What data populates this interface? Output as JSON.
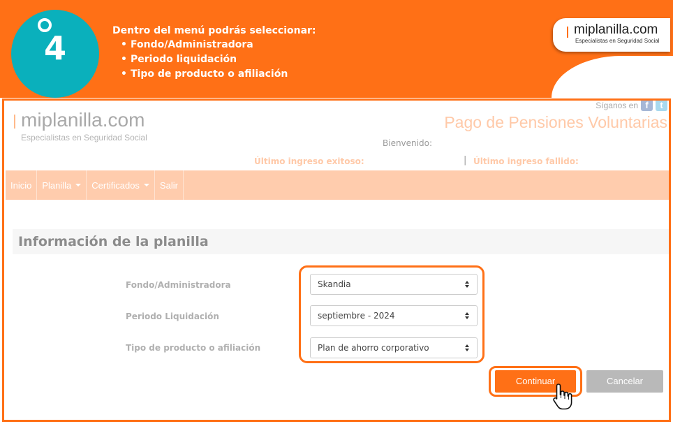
{
  "banner": {
    "step_number": "4",
    "intro": "Dentro del menú podrás seleccionar:",
    "items": [
      "Fondo/Administradora",
      "Periodo liquidación",
      "Tipo de producto o afiliación"
    ],
    "logo_name": "miplanilla.com",
    "logo_tagline": "Especialistas en Seguridad Social"
  },
  "site": {
    "logo_name": "miplanilla.com",
    "logo_tagline": "Especialistas en Seguridad Social",
    "follow_label": "Síganos en",
    "social_icons": [
      "facebook-icon",
      "twitter-icon"
    ],
    "page_heading": "Pago de Pensiones Voluntarias",
    "welcome": "Bienvenido:",
    "last_success_label": "Último ingreso exitoso:",
    "last_fail_label": "Último ingreso fallido:",
    "separator": "|"
  },
  "nav": {
    "items": [
      {
        "label": "Inicio",
        "dropdown": false
      },
      {
        "label": "Planilla",
        "dropdown": true
      },
      {
        "label": "Certificados",
        "dropdown": true
      },
      {
        "label": "Salir",
        "dropdown": false
      }
    ]
  },
  "form": {
    "section_title": "Información de la planilla",
    "fields": [
      {
        "label": "Fondo/Administradora",
        "value": "Skandia"
      },
      {
        "label": "Periodo Liquidación",
        "value": "septiembre - 2024"
      },
      {
        "label": "Tipo de producto o afiliación",
        "value": "Plan de ahorro corporativo"
      }
    ],
    "continue_label": "Continuar",
    "cancel_label": "Cancelar"
  },
  "colors": {
    "brand_orange": "#ff7016",
    "teal": "#0ab0bc",
    "nav_bg": "#ffccad",
    "cancel_gray": "#b9b9b9"
  }
}
